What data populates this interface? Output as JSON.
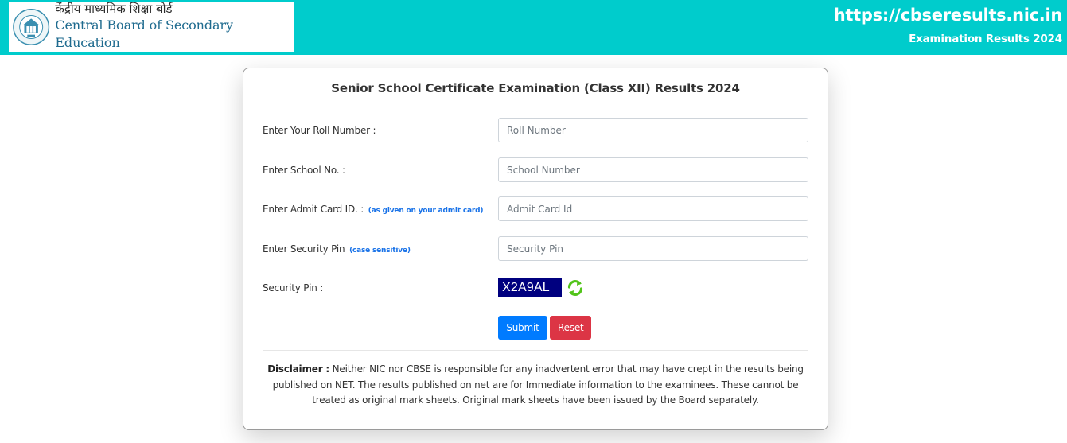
{
  "header": {
    "logo_hindi": "केंद्रीय माध्यमिक शिक्षा बोर्ड",
    "logo_english": "Central Board of Secondary Education",
    "logo_icon": "cbse-emblem-icon",
    "site_url": "https://cbseresults.nic.in",
    "site_subtitle": "Examination Results 2024",
    "bg_color": "#00cccc"
  },
  "form": {
    "title": "Senior School Certificate Examination (Class XII) Results 2024",
    "fields": [
      {
        "label": "Enter Your Roll Number :",
        "hint": "",
        "placeholder": "Roll Number",
        "value": ""
      },
      {
        "label": "Enter School No. :",
        "hint": "",
        "placeholder": "School Number",
        "value": ""
      },
      {
        "label": "Enter Admit Card ID. :",
        "hint": "(as given on your admit card)",
        "placeholder": "Admit Card Id",
        "value": ""
      },
      {
        "label": "Enter Security Pin",
        "hint": "(case sensitive)",
        "placeholder": "Security Pin",
        "value": ""
      }
    ],
    "captcha": {
      "label": "Security Pin :",
      "code": "X2A9AL",
      "refresh_icon": "refresh-icon"
    },
    "submit_label": "Submit",
    "reset_label": "Reset",
    "colors": {
      "submit": "#007bff",
      "reset": "#dc3545",
      "hint": "#1a73e8",
      "captcha_bg": "#00007f"
    }
  },
  "disclaimer": {
    "heading": "Disclaimer :",
    "text": " Neither NIC nor CBSE is responsible for any inadvertent error that may have crept in the results being published on NET. The results published on net are for Immediate information to the examinees. These cannot be treated as original mark sheets. Original mark sheets have been issued by the Board separately."
  }
}
